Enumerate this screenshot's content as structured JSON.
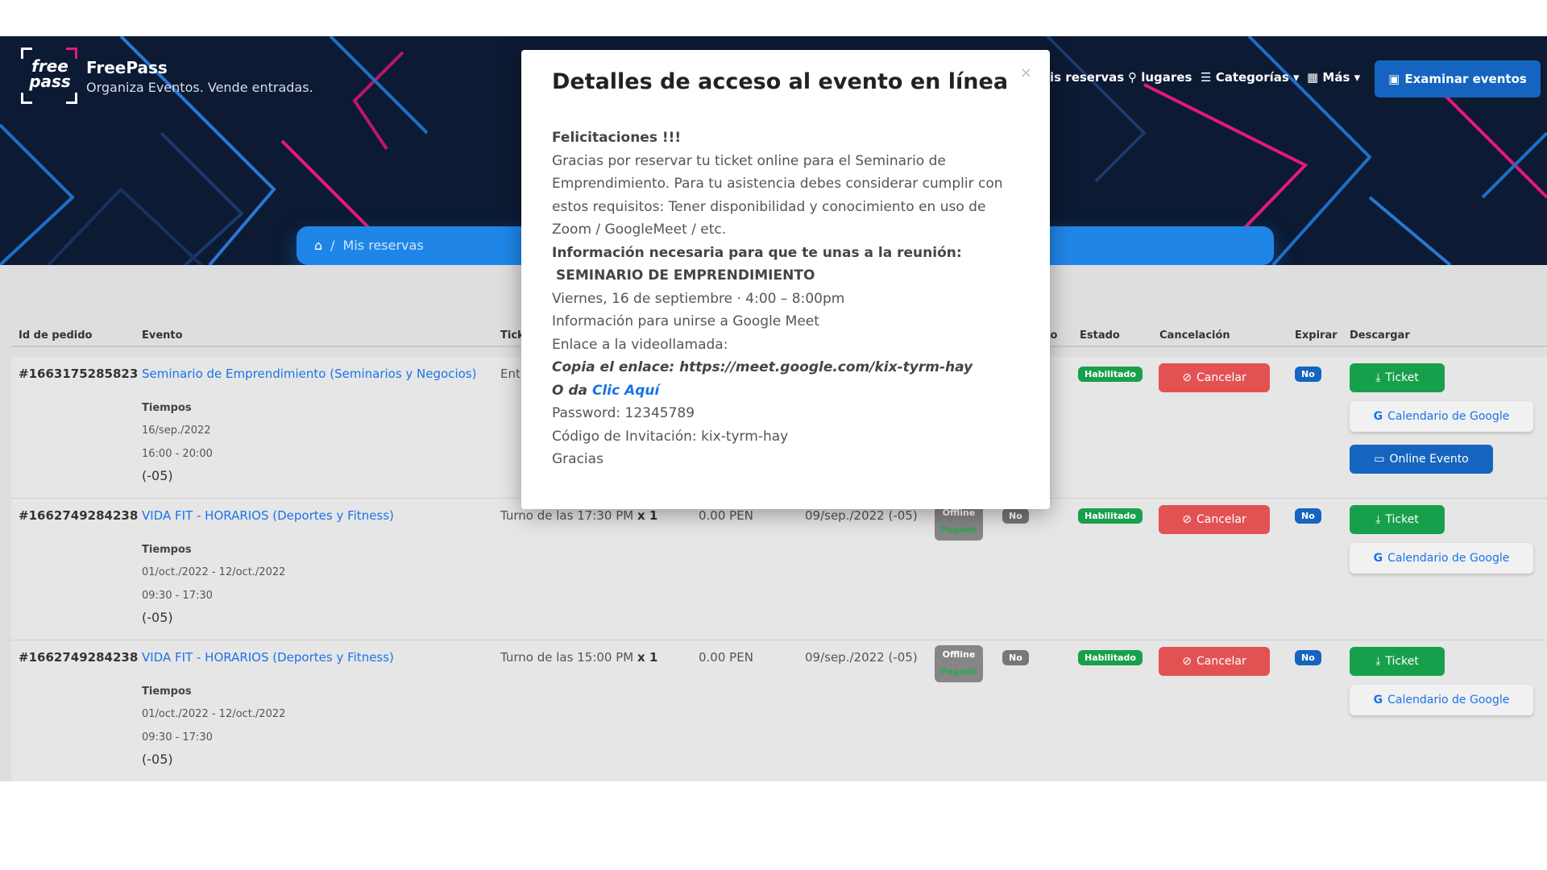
{
  "header": {
    "brand": "FreePass",
    "tagline": "Organiza Eventos. Vende entradas.",
    "logo_text_top": "free",
    "logo_text_bottom": "pass",
    "nav": {
      "reservas": "is reservas",
      "lugares": "lugares",
      "categorias": "Categorías",
      "mas": "Más"
    },
    "browse_button": "Examinar eventos"
  },
  "breadcrumb": {
    "current": "Mis reservas",
    "separator": "/"
  },
  "table": {
    "headers": {
      "id": "Id de pedido",
      "evento": "Evento",
      "ticket": "Tick",
      "pagado": "lo",
      "estado": "Estado",
      "cancelacion": "Cancelación",
      "expirar": "Expirar",
      "descargar": "Descargar"
    },
    "rows": [
      {
        "id": "#1663175285823",
        "event": "Seminario de Emprendimiento (Seminarios y Negocios)",
        "times_label": "Tiempos",
        "dates": "16/sep./2022",
        "hours": "16:00 - 20:00",
        "tz": "(-05)",
        "ticket": "Ent",
        "estado": "Habilitado",
        "cancel": "Cancelar",
        "expirar": "No",
        "ticket_btn": "Ticket",
        "gcal_btn": "Calendario de Google",
        "online_btn": "Online Evento"
      },
      {
        "id": "#1662749284238",
        "event": "VIDA FIT - HORARIOS (Deportes y Fitness)",
        "times_label": "Tiempos",
        "dates": "01/oct./2022 - 12/oct./2022",
        "hours": "09:30 - 17:30",
        "tz": "(-05)",
        "ticket": "Turno de las 17:30 PM",
        "qty": "x 1",
        "price": "0.00 PEN",
        "booked": "09/sep./2022 (-05)",
        "mode": "Offline",
        "paid": "Pagado",
        "checked": "No",
        "estado": "Habilitado",
        "cancel": "Cancelar",
        "expirar": "No",
        "ticket_btn": "Ticket",
        "gcal_btn": "Calendario de Google"
      },
      {
        "id": "#1662749284238",
        "event": "VIDA FIT - HORARIOS (Deportes y Fitness)",
        "times_label": "Tiempos",
        "dates": "01/oct./2022 - 12/oct./2022",
        "hours": "09:30 - 17:30",
        "tz": "(-05)",
        "ticket": "Turno de las 15:00 PM",
        "qty": "x 1",
        "price": "0.00 PEN",
        "booked": "09/sep./2022 (-05)",
        "mode": "Offline",
        "paid": "Pagado",
        "checked": "No",
        "estado": "Habilitado",
        "cancel": "Cancelar",
        "expirar": "No",
        "ticket_btn": "Ticket",
        "gcal_btn": "Calendario de Google"
      }
    ]
  },
  "modal": {
    "title": "Detalles de acceso al evento en línea",
    "close": "×",
    "lines": {
      "congrats": "Felicitaciones !!!",
      "thanks": "Gracias por reservar tu ticket online para el Seminario de Emprendimiento. Para tu asistencia debes considerar cumplir con estos requisitos: Tener disponibilidad y conocimiento en uso de Zoom / GoogleMeet / etc.",
      "info_heading": "Información necesaria para que te unas a la reunión:",
      "seminar": "SEMINARIO DE EMPRENDIMIENTO",
      "when": "Viernes, 16 de septiembre · 4:00 – 8:00pm",
      "meet_info": "Información para unirse a Google Meet",
      "videocall": "Enlace a la videollamada:",
      "copy_link": "Copia el enlace: https://meet.google.com/kix-tyrm-hay",
      "or_prefix": "O da ",
      "click_here": "Clic Aquí",
      "password": "Password: 12345789",
      "invite": "Código de Invitación: kix-tyrm-hay",
      "bye": "Gracias"
    }
  },
  "colors": {
    "header_bg": "#0c1a33",
    "accent_blue": "#1f86e8",
    "green": "#17a04b",
    "red": "#e35252",
    "pink": "#e7177c"
  }
}
